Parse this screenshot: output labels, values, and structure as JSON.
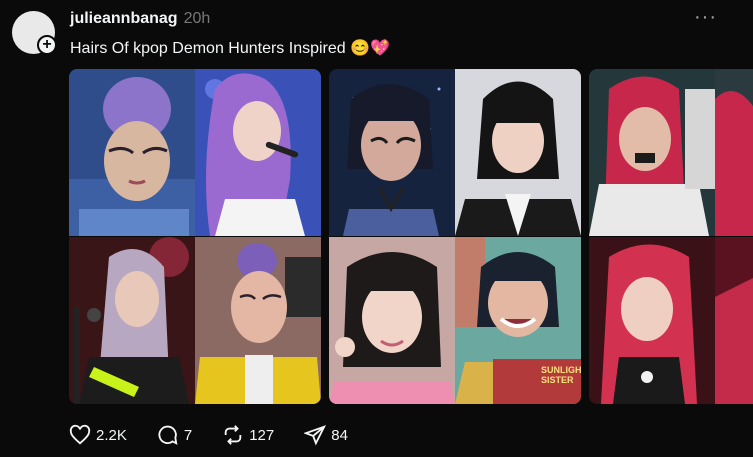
{
  "post": {
    "username": "julieannbanag",
    "time": "20h",
    "more": "···",
    "caption": "Hairs Of kpop Demon Hunters Inspired 😊💖"
  },
  "actions": {
    "likes": "2.2K",
    "comments": "7",
    "reposts": "127",
    "shares": "84"
  },
  "tiles": {
    "c2_bottom_right_sign": "SUNLIGHT SISTER"
  },
  "icons": [
    "plus-icon",
    "more-icon",
    "heart-icon",
    "comment-icon",
    "repost-icon",
    "share-icon"
  ]
}
